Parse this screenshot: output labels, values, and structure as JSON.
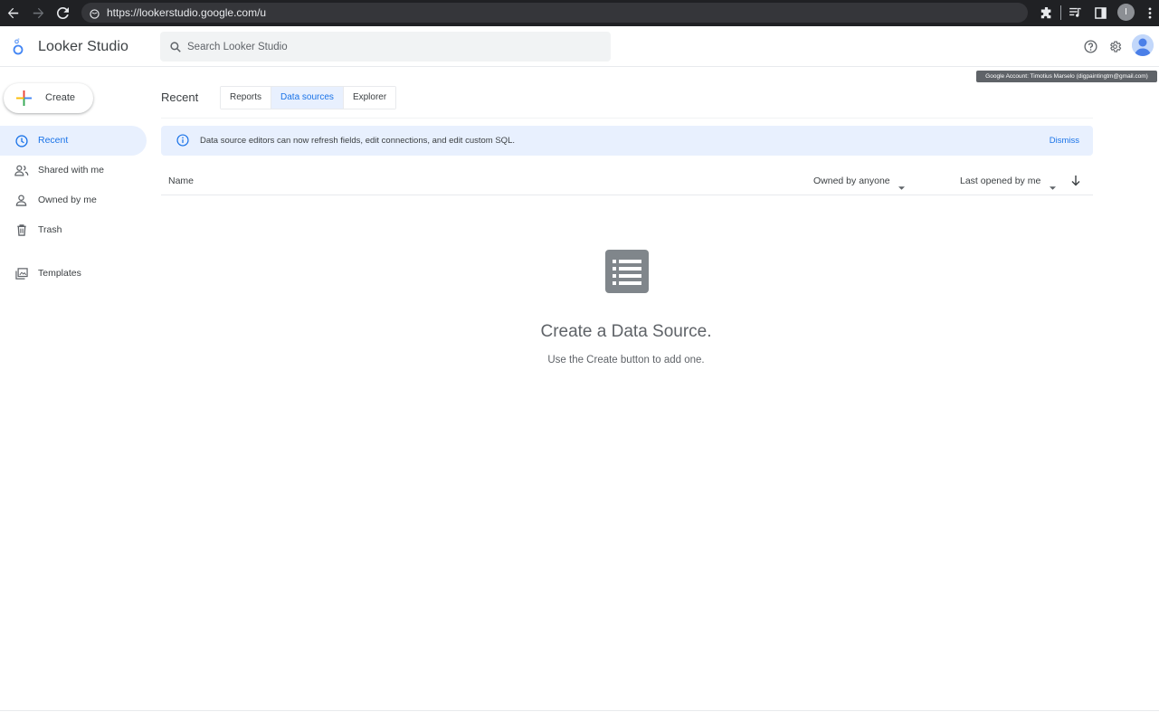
{
  "browser": {
    "url": "https://lookerstudio.google.com/u",
    "profile_initial": "I"
  },
  "header": {
    "app_title": "Looker Studio",
    "search_placeholder": "Search Looker Studio",
    "account_tooltip": "Google Account: Timotius Marselo (digpaintingtm@gmail.com)"
  },
  "sidebar": {
    "create_label": "Create",
    "items": [
      {
        "label": "Recent",
        "icon": "clock-icon",
        "active": true
      },
      {
        "label": "Shared with me",
        "icon": "people-icon",
        "active": false
      },
      {
        "label": "Owned by me",
        "icon": "person-icon",
        "active": false
      },
      {
        "label": "Trash",
        "icon": "trash-icon",
        "active": false
      },
      {
        "label": "Templates",
        "icon": "templates-icon",
        "active": false
      }
    ]
  },
  "main": {
    "title": "Recent",
    "tabs": [
      {
        "label": "Reports",
        "active": false
      },
      {
        "label": "Data sources",
        "active": true
      },
      {
        "label": "Explorer",
        "active": false
      }
    ],
    "banner": {
      "message": "Data source editors can now refresh fields, edit connections, and edit custom SQL.",
      "dismiss_label": "Dismiss"
    },
    "list_header": {
      "name_label": "Name",
      "owner_filter": "Owned by anyone",
      "sort_label": "Last opened by me"
    },
    "empty_state": {
      "title": "Create a Data Source.",
      "subtitle": "Use the Create button to add one."
    }
  },
  "colors": {
    "accent": "#1a73e8",
    "active_bg": "#e8f0fe",
    "chrome_bg": "#202124"
  }
}
